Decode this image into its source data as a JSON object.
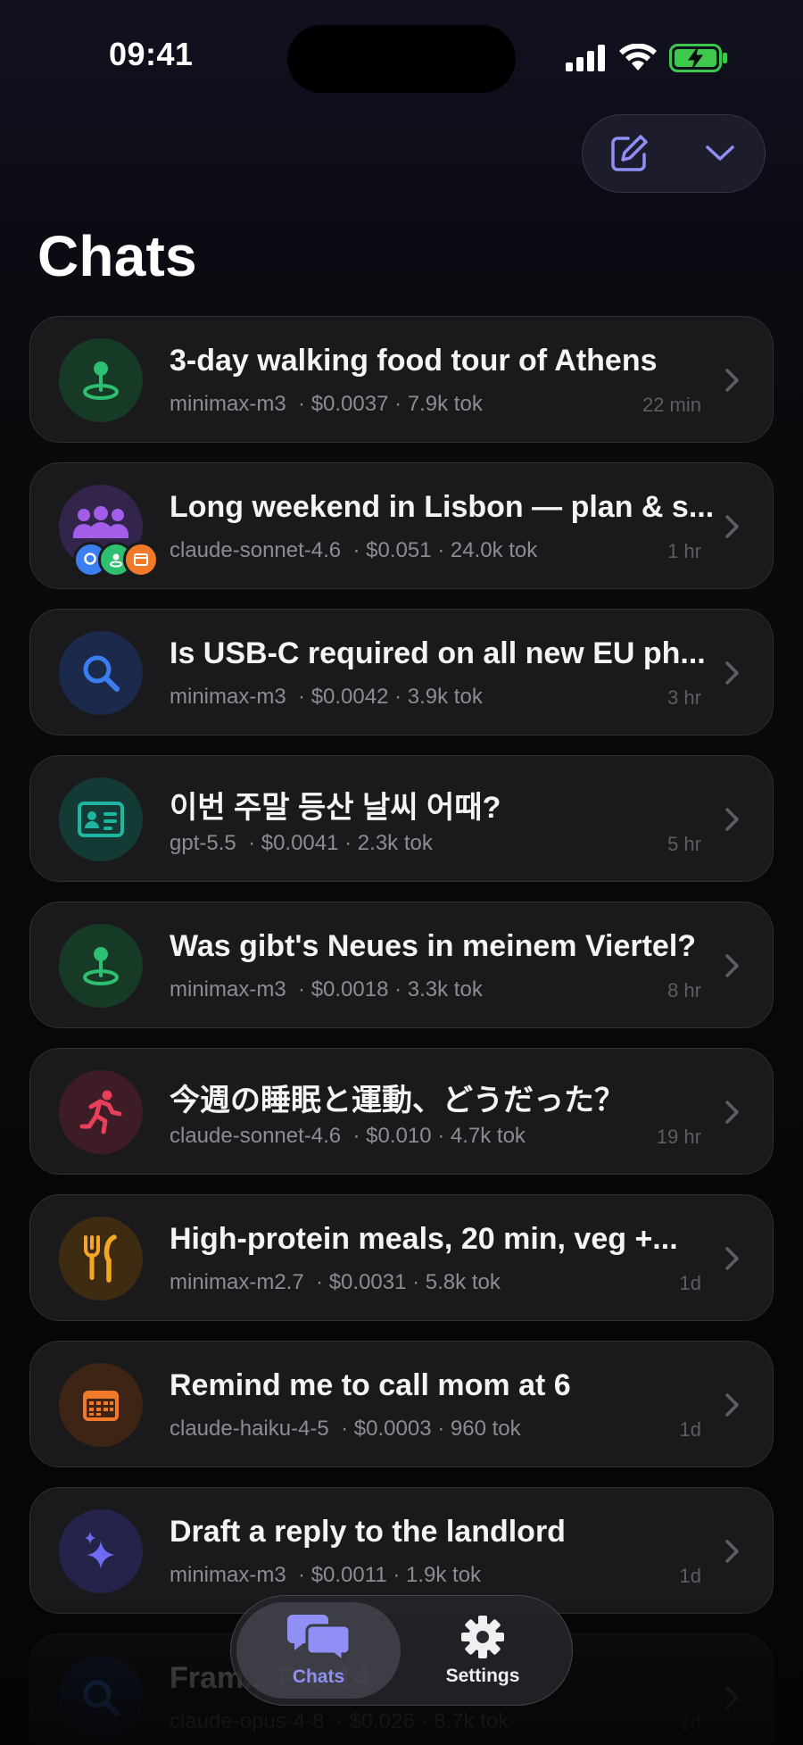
{
  "status_bar": {
    "time": "09:41"
  },
  "header": {
    "title": "Chats",
    "compose_icon": "compose-icon",
    "menu_icon": "chevron-down-icon"
  },
  "chats": [
    {
      "title": "3-day walking food tour of Athens",
      "model": "minimax-m3",
      "stats": "· $0.0037 · 7.9k tok",
      "time": "22 min",
      "icon": "map-pin-icon",
      "color": "#2fbf71"
    },
    {
      "title": "Long weekend in Lisbon — plan & s...",
      "model": "claude-sonnet-4.6",
      "stats": "· $0.051 · 24.0k tok",
      "time": "1 hr",
      "icon": "people-group-icon",
      "color": "#a25ee8"
    },
    {
      "title": "Is USB-C required on all new EU ph...",
      "model": "minimax-m3",
      "stats": "· $0.0042 · 3.9k tok",
      "time": "3 hr",
      "icon": "search-icon",
      "color": "#3a7ef0"
    },
    {
      "title": "이번 주말 등산 날씨 어때?",
      "model": "gpt-5.5",
      "stats": "· $0.0041 · 2.3k tok",
      "time": "5 hr",
      "icon": "id-card-icon",
      "color": "#20b5a0"
    },
    {
      "title": "Was gibt's Neues in meinem Viertel?",
      "model": "minimax-m3",
      "stats": "· $0.0018 · 3.3k tok",
      "time": "8 hr",
      "icon": "map-pin-icon",
      "color": "#2fbf71"
    },
    {
      "title": "今週の睡眠と運動、どうだった？",
      "model": "claude-sonnet-4.6",
      "stats": "· $0.010 · 4.7k tok",
      "time": "19 hr",
      "icon": "running-icon",
      "color": "#e8405a"
    },
    {
      "title": "High-protein meals, 20 min, veg +...",
      "model": "minimax-m2.7",
      "stats": "· $0.0031 · 5.8k tok",
      "time": "1d",
      "icon": "fork-knife-icon",
      "color": "#f5a623"
    },
    {
      "title": "Remind me to call mom at 6",
      "model": "claude-haiku-4-5",
      "stats": "· $0.0003 · 960 tok",
      "time": "1d",
      "icon": "calendar-icon",
      "color": "#f07a2a"
    },
    {
      "title": "Draft a reply to the landlord",
      "model": "minimax-m3",
      "stats": "· $0.0011 · 1.9k tok",
      "time": "1d",
      "icon": "sparkles-icon",
      "color": "#6d6cf0"
    },
    {
      "title": "Fram... Pro 14",
      "model": "claude-opus-4-8",
      "stats": "· $0.026 · 8.7k tok",
      "time": "2d",
      "icon": "search-icon",
      "color": "#3a7ef0"
    }
  ],
  "tab_bar": {
    "tabs": [
      {
        "label": "Chats",
        "icon": "chat-bubbles-icon",
        "active": true
      },
      {
        "label": "Settings",
        "icon": "gear-icon",
        "active": false
      }
    ]
  },
  "colors": {
    "accent": "#8f8ff5",
    "background": "#050507",
    "row": "#1a1a1d"
  }
}
